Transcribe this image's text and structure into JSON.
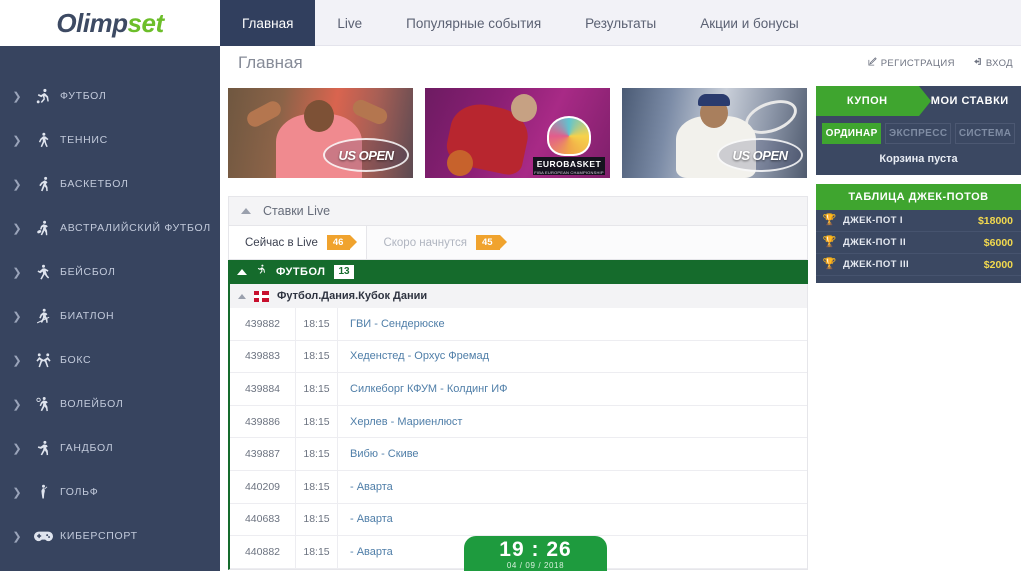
{
  "brand": {
    "part1": "Olimp",
    "part2": "set"
  },
  "nav": {
    "items": [
      {
        "label": "Главная",
        "active": true
      },
      {
        "label": "Live",
        "active": false
      },
      {
        "label": "Популярные события",
        "active": false
      },
      {
        "label": "Результаты",
        "active": false
      },
      {
        "label": "Акции и бонусы",
        "active": false
      }
    ]
  },
  "header": {
    "page_title": "Главная",
    "register_label": "РЕГИСТРАЦИЯ",
    "register_icon": "edit-icon",
    "login_label": "ВХОД",
    "login_icon": "login-icon"
  },
  "sidebar": {
    "items": [
      {
        "label": "ФУТБОЛ",
        "icon": "soccer-icon"
      },
      {
        "label": "ТЕННИС",
        "icon": "tennis-icon"
      },
      {
        "label": "БАСКЕТБОЛ",
        "icon": "basketball-icon"
      },
      {
        "label": "АВСТРАЛИЙСКИЙ ФУТБОЛ",
        "icon": "aussie-football-icon"
      },
      {
        "label": "БЕЙСБОЛ",
        "icon": "baseball-icon"
      },
      {
        "label": "БИАТЛОН",
        "icon": "biathlon-icon"
      },
      {
        "label": "БОКС",
        "icon": "boxing-icon"
      },
      {
        "label": "ВОЛЕЙБОЛ",
        "icon": "volleyball-icon"
      },
      {
        "label": "ГАНДБОЛ",
        "icon": "handball-icon"
      },
      {
        "label": "ГОЛЬФ",
        "icon": "golf-icon"
      },
      {
        "label": "КИБЕРСПОРТ",
        "icon": "esports-icon"
      }
    ]
  },
  "banners": [
    {
      "name": "us-open-nadal",
      "logo": "US OPEN"
    },
    {
      "name": "eurobasket",
      "logo": "EUROBASKET",
      "sub": "FIBA EUROPEAN CHAMPIONSHIP"
    },
    {
      "name": "us-open-federer",
      "logo": "US OPEN"
    }
  ],
  "live": {
    "panel_title": "Ставки Live",
    "tabs": [
      {
        "label": "Сейчас в Live",
        "count": "46",
        "active": true
      },
      {
        "label": "Скоро начнутся",
        "count": "45",
        "active": false
      }
    ],
    "sport": {
      "name": "ФУТБОЛ",
      "count": "13",
      "icon": "soccer-icon"
    },
    "league": {
      "name": "Футбол.Дания.Кубок Дании",
      "flag": "denmark-flag"
    },
    "matches": [
      {
        "id": "439882",
        "time": "18:15",
        "teams": "ГВИ - Сендерюске"
      },
      {
        "id": "439883",
        "time": "18:15",
        "teams": "Хеденстед - Орхус Фремад"
      },
      {
        "id": "439884",
        "time": "18:15",
        "teams": "Силкеборг КФУМ - Колдинг ИФ"
      },
      {
        "id": "439886",
        "time": "18:15",
        "teams": "Херлев - Мариенлюст"
      },
      {
        "id": "439887",
        "time": "18:15",
        "teams": "Вибю - Скиве"
      },
      {
        "id": "440209",
        "time": "18:15",
        "teams": "- Аварта"
      },
      {
        "id": "440683",
        "time": "18:15",
        "teams": "- Аварта"
      },
      {
        "id": "440882",
        "time": "18:15",
        "teams": "- Аварта"
      }
    ]
  },
  "coupon": {
    "tabs": [
      {
        "label": "КУПОН",
        "active": true
      },
      {
        "label": "МОИ СТАВКИ",
        "active": false
      }
    ],
    "bet_types": [
      {
        "label": "ОРДИНАР",
        "active": true
      },
      {
        "label": "ЭКСПРЕСС",
        "active": false
      },
      {
        "label": "СИСТЕМА",
        "active": false
      }
    ],
    "empty_text": "Корзина пуста"
  },
  "jackpot": {
    "title": "ТАБЛИЦА ДЖЕК-ПОТОВ",
    "rows": [
      {
        "label": "ДЖЕК-ПОТ I",
        "value": "$18000",
        "medal": "gold-trophy-icon",
        "color": "#f0c419"
      },
      {
        "label": "ДЖЕК-ПОТ II",
        "value": "$6000",
        "medal": "silver-trophy-icon",
        "color": "#d4d9e2"
      },
      {
        "label": "ДЖЕК-ПОТ III",
        "value": "$2000",
        "medal": "bronze-trophy-icon",
        "color": "#cd7f32"
      }
    ]
  },
  "clock": {
    "time": "19 : 26",
    "date": "04 / 09 / 2018"
  },
  "colors": {
    "nav_active": "#313f5e",
    "sidebar_bg": "#37445f",
    "green": "#3fa52f",
    "dark_green": "#156b2c",
    "orange": "#f0a32e",
    "gold": "#f2d94e"
  }
}
